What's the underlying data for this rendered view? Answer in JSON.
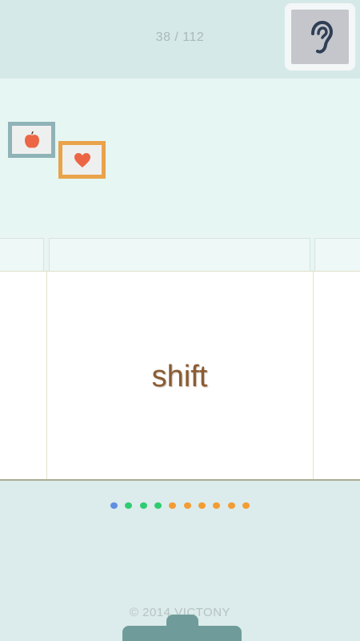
{
  "header": {
    "progress_label": "38 / 112",
    "listen_icon": "ear-icon"
  },
  "wall": {
    "frames": [
      {
        "icon": "apple-icon",
        "frame_color": "#8fb3b7",
        "icon_color": "#ec6645"
      },
      {
        "icon": "heart-icon",
        "frame_color": "#e9a34a",
        "icon_color": "#ec6645"
      }
    ]
  },
  "card": {
    "word": "shift"
  },
  "pager": {
    "dots": [
      {
        "color": "#5f8fe1",
        "active": true
      },
      {
        "color": "#2ecc71"
      },
      {
        "color": "#2ecc71"
      },
      {
        "color": "#2ecc71"
      },
      {
        "color": "#f39c34"
      },
      {
        "color": "#f39c34"
      },
      {
        "color": "#f39c34"
      },
      {
        "color": "#f39c34"
      },
      {
        "color": "#f39c34"
      },
      {
        "color": "#f39c34"
      }
    ]
  },
  "footer": {
    "copyright": "© 2014 VICTONY"
  }
}
